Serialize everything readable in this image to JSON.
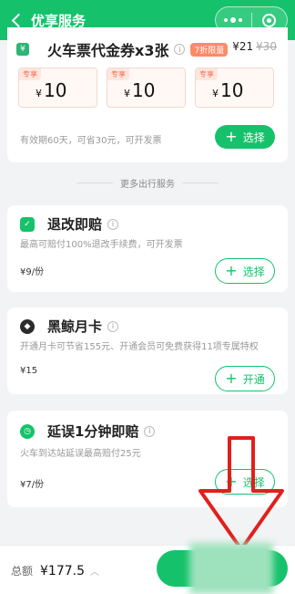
{
  "header": {
    "title": "优享服务"
  },
  "voucher": {
    "icon": "¥",
    "title": "火车票代金券x3张",
    "badge": "7折限量",
    "price": "¥21",
    "old_price": "¥30",
    "tickets": [
      {
        "tag": "专享",
        "currency": "¥",
        "amount": "10"
      },
      {
        "tag": "专享",
        "currency": "¥",
        "amount": "10"
      },
      {
        "tag": "专享",
        "currency": "¥",
        "amount": "10"
      }
    ],
    "note": "有效期60天，可省30元，可开发票",
    "button": "选择"
  },
  "divider": "更多出行服务",
  "services": [
    {
      "title": "退改即赔",
      "desc": "最高可赔付100%退改手续费，可开发票",
      "price": "¥9/份",
      "button": "选择",
      "icon_color": "#15c26b"
    },
    {
      "title": "黑鲸月卡",
      "desc": "开通月卡可节省155元、开通会员可免费获得11项专属特权",
      "price": "¥15",
      "button": "开通",
      "icon_color": "#2b2b2b"
    },
    {
      "title": "延误1分钟即赔",
      "desc": "火车到达站延误最高赔付25元",
      "price": "¥7/份",
      "button": "选择",
      "icon_color": "#15c26b"
    }
  ],
  "footer": {
    "total_label": "总额",
    "total_value": "¥177.5"
  },
  "colors": {
    "brand": "#15c26b",
    "accent": "#ff8a66"
  }
}
